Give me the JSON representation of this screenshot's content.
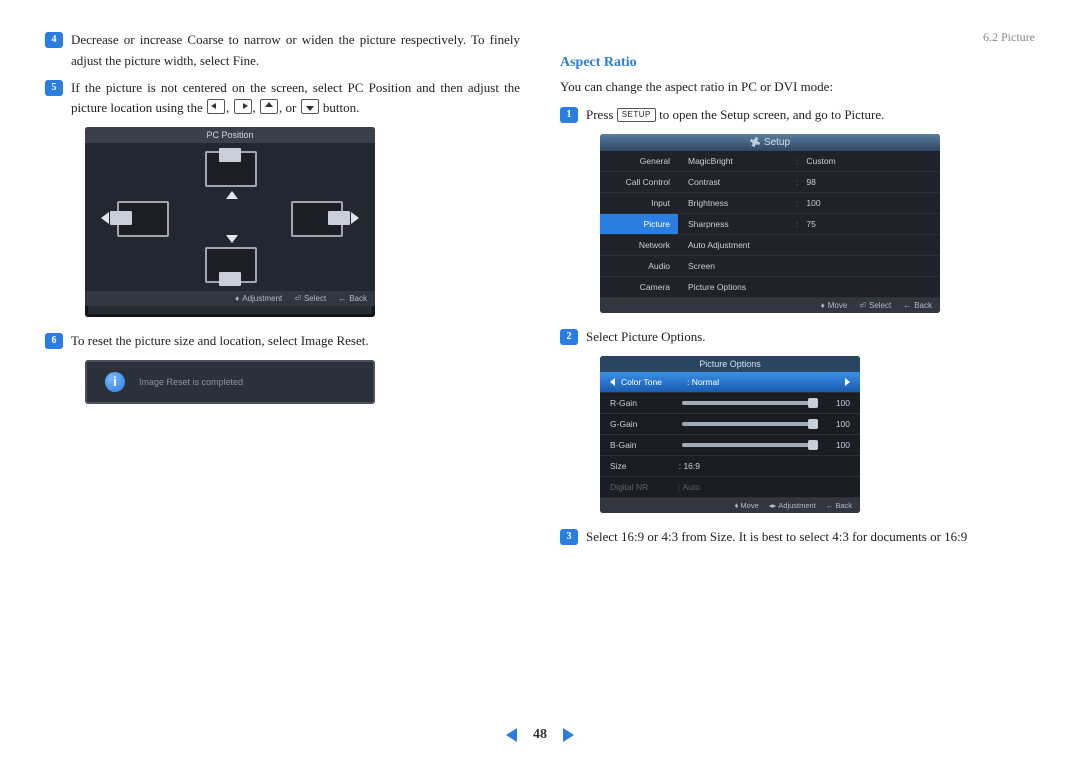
{
  "header": {
    "section_label": "6.2 Picture"
  },
  "left_col": {
    "step4": "Decrease or increase Coarse to narrow or widen the picture respectively. To finely adjust the picture width, select Fine.",
    "step5_a": "If the picture is not centered on the screen, select PC Position and then adjust the picture location using the ",
    "step5_b": " button.",
    "or_text": ", or ",
    "comma": ", ",
    "step6": "To reset the picture size and location, select Image Reset.",
    "pcpos_title": "PC Position",
    "pcpos_footer": {
      "adjustment": "Adjustment",
      "select": "Select",
      "back": "Back"
    },
    "reset_msg": "Image Reset is completed"
  },
  "right_col": {
    "heading": "Aspect Ratio",
    "intro": "You can change the aspect ratio in PC or DVI mode:",
    "step1_a": "Press ",
    "setup_btn": "SETUP",
    "step1_b": " to open the Setup screen, and go to Picture.",
    "step2": "Select Picture Options.",
    "step3": "Select 16:9 or 4:3 from Size. It is best to select 4:3 for documents or 16:9",
    "setup_fig": {
      "title": "Setup",
      "nav": [
        "General",
        "Call Control",
        "Input",
        "Picture",
        "Network",
        "Audio",
        "Camera"
      ],
      "nav_active_index": 3,
      "rows": [
        {
          "label": "MagicBright",
          "val": "Custom"
        },
        {
          "label": "Contrast",
          "val": "98"
        },
        {
          "label": "Brightness",
          "val": "100"
        },
        {
          "label": "Sharpness",
          "val": "75"
        },
        {
          "label": "Auto Adjustment",
          "val": ""
        },
        {
          "label": "Screen",
          "val": ""
        },
        {
          "label": "Picture Options",
          "val": ""
        }
      ],
      "footer": {
        "move": "Move",
        "select": "Select",
        "back": "Back"
      }
    },
    "picopt_fig": {
      "title": "Picture Options",
      "rows": [
        {
          "label": "Color Tone",
          "val": "Normal",
          "type": "select"
        },
        {
          "label": "R-Gain",
          "val": "100",
          "type": "slider"
        },
        {
          "label": "G-Gain",
          "val": "100",
          "type": "slider"
        },
        {
          "label": "B-Gain",
          "val": "100",
          "type": "slider"
        },
        {
          "label": "Size",
          "val": "16:9",
          "type": "text"
        },
        {
          "label": "Digital NR",
          "val": "Auto",
          "type": "dim"
        }
      ],
      "footer": {
        "move": "Move",
        "adjustment": "Adjustment",
        "back": "Back"
      }
    }
  },
  "pager": {
    "num": "48"
  }
}
